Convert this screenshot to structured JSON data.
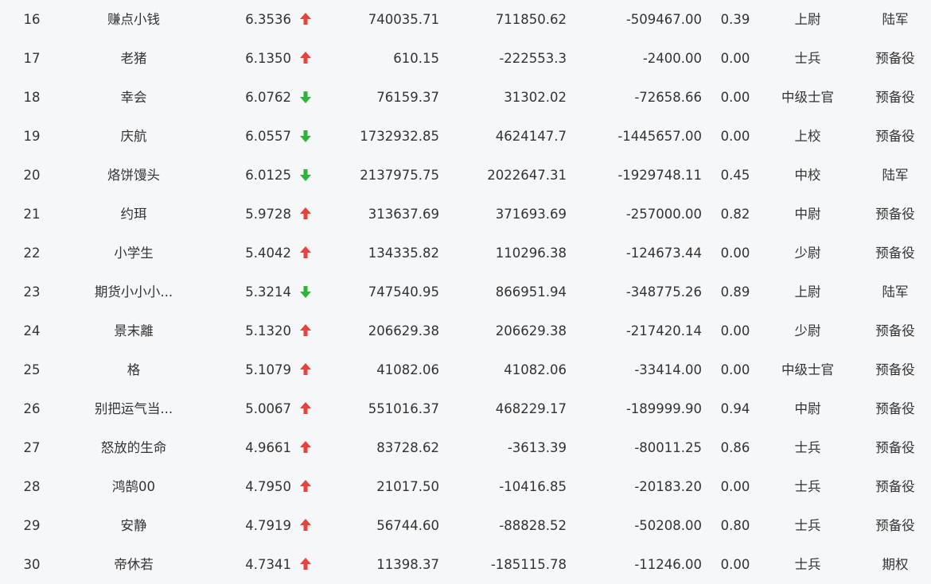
{
  "colors": {
    "up": "#e8433a",
    "down": "#2db53a",
    "text": "#333333",
    "background": "#f6f7f9"
  },
  "rows": [
    {
      "rank": "16",
      "name": "赚点小钱",
      "score": "6.3536",
      "trend": "up",
      "v1": "740035.71",
      "v2": "711850.62",
      "v3": "-509467.00",
      "ratio": "0.39",
      "title": "上尉",
      "branch": "陆军"
    },
    {
      "rank": "17",
      "name": "老猪",
      "score": "6.1350",
      "trend": "up",
      "v1": "610.15",
      "v2": "-222553.3",
      "v3": "-2400.00",
      "ratio": "0.00",
      "title": "士兵",
      "branch": "预备役"
    },
    {
      "rank": "18",
      "name": "幸会",
      "score": "6.0762",
      "trend": "down",
      "v1": "76159.37",
      "v2": "31302.02",
      "v3": "-72658.66",
      "ratio": "0.00",
      "title": "中级士官",
      "branch": "预备役"
    },
    {
      "rank": "19",
      "name": "庆航",
      "score": "6.0557",
      "trend": "down",
      "v1": "1732932.85",
      "v2": "4624147.7",
      "v3": "-1445657.00",
      "ratio": "0.00",
      "title": "上校",
      "branch": "预备役"
    },
    {
      "rank": "20",
      "name": "烙饼馒头",
      "score": "6.0125",
      "trend": "down",
      "v1": "2137975.75",
      "v2": "2022647.31",
      "v3": "-1929748.11",
      "ratio": "0.45",
      "title": "中校",
      "branch": "陆军"
    },
    {
      "rank": "21",
      "name": "约珥",
      "score": "5.9728",
      "trend": "up",
      "v1": "313637.69",
      "v2": "371693.69",
      "v3": "-257000.00",
      "ratio": "0.82",
      "title": "中尉",
      "branch": "预备役"
    },
    {
      "rank": "22",
      "name": "小学生",
      "score": "5.4042",
      "trend": "up",
      "v1": "134335.82",
      "v2": "110296.38",
      "v3": "-124673.44",
      "ratio": "0.00",
      "title": "少尉",
      "branch": "预备役"
    },
    {
      "rank": "23",
      "name": "期货小小小...",
      "score": "5.3214",
      "trend": "down",
      "v1": "747540.95",
      "v2": "866951.94",
      "v3": "-348775.26",
      "ratio": "0.89",
      "title": "上尉",
      "branch": "陆军"
    },
    {
      "rank": "24",
      "name": "景末離",
      "score": "5.1320",
      "trend": "up",
      "v1": "206629.38",
      "v2": "206629.38",
      "v3": "-217420.14",
      "ratio": "0.00",
      "title": "少尉",
      "branch": "预备役"
    },
    {
      "rank": "25",
      "name": "格",
      "score": "5.1079",
      "trend": "up",
      "v1": "41082.06",
      "v2": "41082.06",
      "v3": "-33414.00",
      "ratio": "0.00",
      "title": "中级士官",
      "branch": "预备役"
    },
    {
      "rank": "26",
      "name": "别把运气当...",
      "score": "5.0067",
      "trend": "up",
      "v1": "551016.37",
      "v2": "468229.17",
      "v3": "-189999.90",
      "ratio": "0.94",
      "title": "中尉",
      "branch": "预备役"
    },
    {
      "rank": "27",
      "name": "怒放的生命",
      "score": "4.9661",
      "trend": "up",
      "v1": "83728.62",
      "v2": "-3613.39",
      "v3": "-80011.25",
      "ratio": "0.86",
      "title": "士兵",
      "branch": "预备役"
    },
    {
      "rank": "28",
      "name": "鸿鹄00",
      "score": "4.7950",
      "trend": "up",
      "v1": "21017.50",
      "v2": "-10416.85",
      "v3": "-20183.20",
      "ratio": "0.00",
      "title": "士兵",
      "branch": "预备役"
    },
    {
      "rank": "29",
      "name": "安静",
      "score": "4.7919",
      "trend": "up",
      "v1": "56744.60",
      "v2": "-88828.52",
      "v3": "-50208.00",
      "ratio": "0.80",
      "title": "士兵",
      "branch": "预备役"
    },
    {
      "rank": "30",
      "name": "帝休若",
      "score": "4.7341",
      "trend": "up",
      "v1": "11398.37",
      "v2": "-185115.78",
      "v3": "-11246.00",
      "ratio": "0.00",
      "title": "士兵",
      "branch": "期权"
    }
  ]
}
